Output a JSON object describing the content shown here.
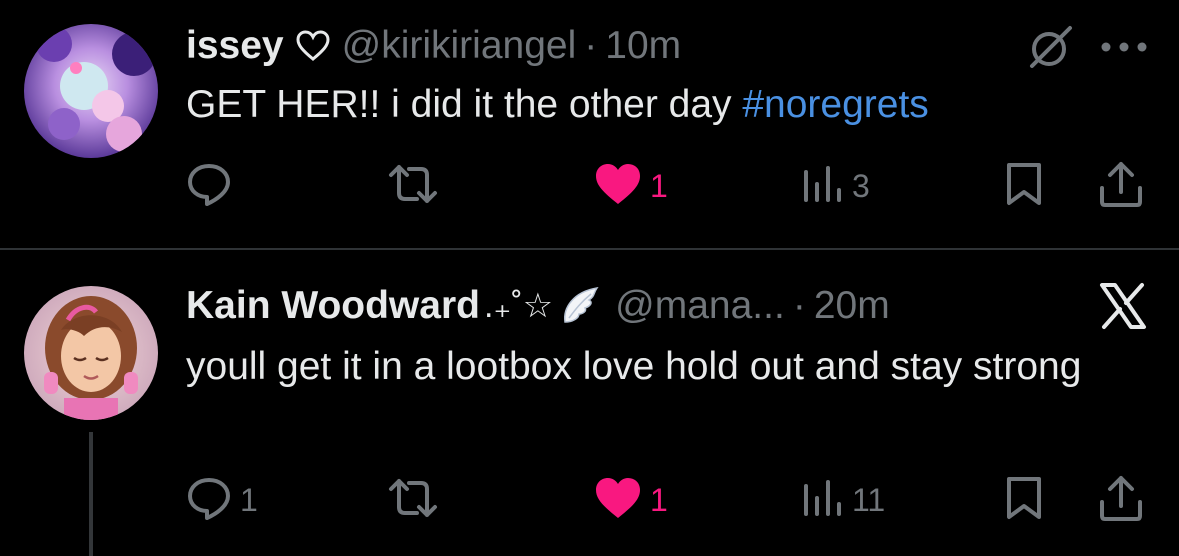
{
  "tweets": [
    {
      "name": "issey",
      "name_badge_icon": "heart-outline-icon",
      "handle": "@kirikiriangel",
      "separator": "·",
      "time": "10m",
      "text_prefix": "GET HER!! i did it the other day ",
      "hashtag": "#noregrets",
      "top_right_icon": "grok-icon",
      "actions": {
        "reply_count": "",
        "retweet_count": "",
        "like_count": "1",
        "liked": true,
        "views_count": "3"
      }
    },
    {
      "name": "Kain Woodward",
      "name_decoration": ".₊˚☆",
      "name_emoji_icon": "angel-wing-icon",
      "handle": "@mana...",
      "separator": "·",
      "time": "20m",
      "text": "youll get it in a lootbox love hold out and stay strong",
      "top_right_icon": "x-logo-icon",
      "actions": {
        "reply_count": "1",
        "retweet_count": "",
        "like_count": "1",
        "liked": true,
        "views_count": "11"
      }
    }
  ],
  "colors": {
    "background": "#000000",
    "primary_text": "#e7e9ea",
    "secondary_text": "#71767b",
    "hashtag": "#4a90e2",
    "like": "#f91880",
    "divider": "#2f3336"
  }
}
